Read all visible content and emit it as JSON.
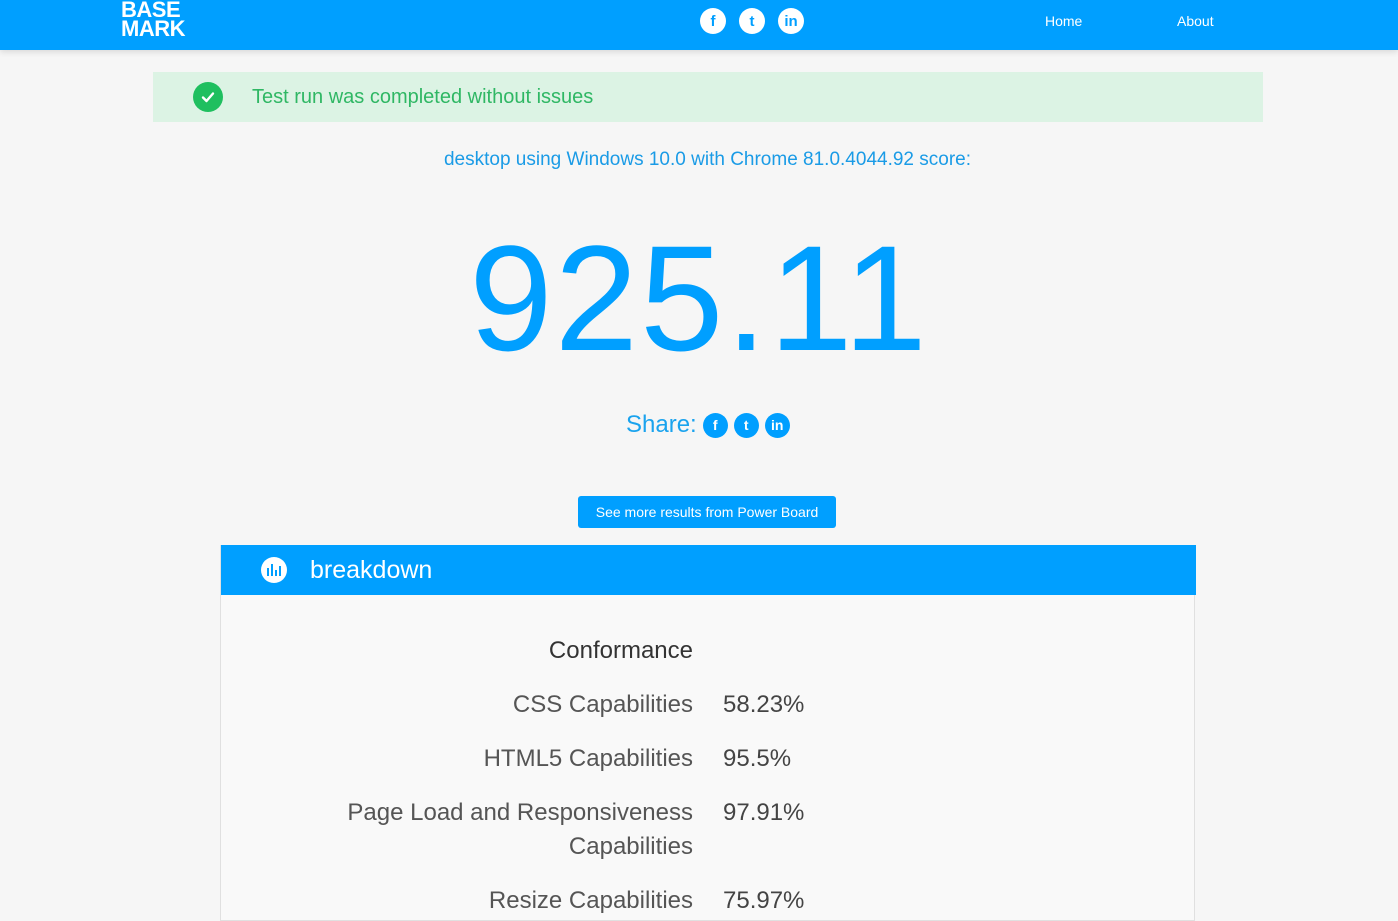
{
  "header": {
    "logo_line1": "BASE",
    "logo_line2": "MARK",
    "social": [
      {
        "icon": "facebook-icon",
        "glyph": "f"
      },
      {
        "icon": "twitter-icon",
        "glyph": "t"
      },
      {
        "icon": "linkedin-icon",
        "glyph": "in"
      }
    ],
    "nav": {
      "home": "Home",
      "about": "About"
    }
  },
  "alert": {
    "message": "Test run was completed without issues",
    "status_color": "#1fbf5f"
  },
  "result": {
    "device_line": "desktop using Windows 10.0 with Chrome 81.0.4044.92 score:",
    "score": "925.11"
  },
  "share": {
    "label": "Share:",
    "icons": [
      "facebook-icon",
      "twitter-icon",
      "linkedin-icon"
    ]
  },
  "more_button": "See more results from Power Board",
  "breakdown": {
    "title": "breakdown",
    "section": "Conformance",
    "rows": [
      {
        "label": "CSS Capabilities",
        "value": "58.23%"
      },
      {
        "label": "HTML5 Capabilities",
        "value": "95.5%"
      },
      {
        "label": "Page Load and Responsiveness Capabilities",
        "value": "97.91%"
      },
      {
        "label": "Resize Capabilities",
        "value": "75.97%"
      }
    ]
  },
  "colors": {
    "accent": "#009fff",
    "background": "#f6f6f6"
  }
}
